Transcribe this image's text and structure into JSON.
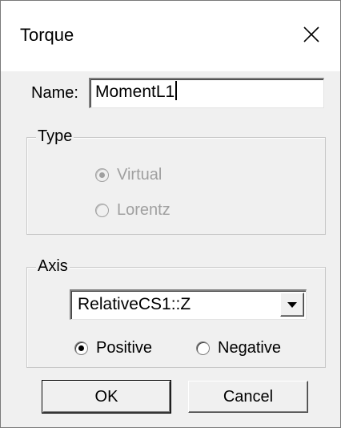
{
  "window": {
    "title": "Torque",
    "close_symbol": "✕"
  },
  "name_field": {
    "label": "Name:",
    "value": "MomentL1"
  },
  "type_group": {
    "legend": "Type",
    "options": [
      {
        "label": "Virtual",
        "selected": true,
        "enabled": false
      },
      {
        "label": "Lorentz",
        "selected": false,
        "enabled": false
      }
    ]
  },
  "axis_group": {
    "legend": "Axis",
    "selected_axis": "RelativeCS1::Z",
    "direction_options": [
      {
        "label": "Positive",
        "selected": true
      },
      {
        "label": "Negative",
        "selected": false
      }
    ]
  },
  "buttons": {
    "ok": "OK",
    "cancel": "Cancel"
  },
  "icons": {
    "close": "close-icon",
    "dropdown": "chevron-down-icon"
  }
}
